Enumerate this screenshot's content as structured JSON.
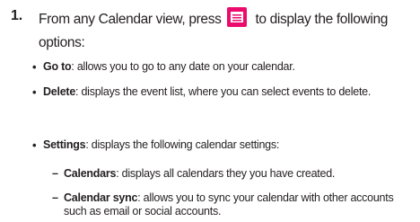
{
  "step": {
    "number": "1.",
    "text_before_icon": "From any Calendar view, press",
    "text_after_icon": "to display the following options:",
    "icon": "menu-key-icon",
    "icon_color": "#ea0b6c"
  },
  "options": [
    {
      "term": "Go to",
      "description": ": allows you to go to any date on your calendar."
    },
    {
      "term": "Delete",
      "description": ": displays the event list, where you can select events to delete."
    },
    {
      "term": "Settings",
      "description": ": displays the following calendar settings:"
    }
  ],
  "settings": [
    {
      "term": "Calendars",
      "description": ": displays all calendars they you have created."
    },
    {
      "term": "Calendar sync",
      "description": ": allows you to sync your calendar with other accounts such as email or social accounts."
    }
  ],
  "symbols": {
    "bullet": "•",
    "dash": "–"
  }
}
